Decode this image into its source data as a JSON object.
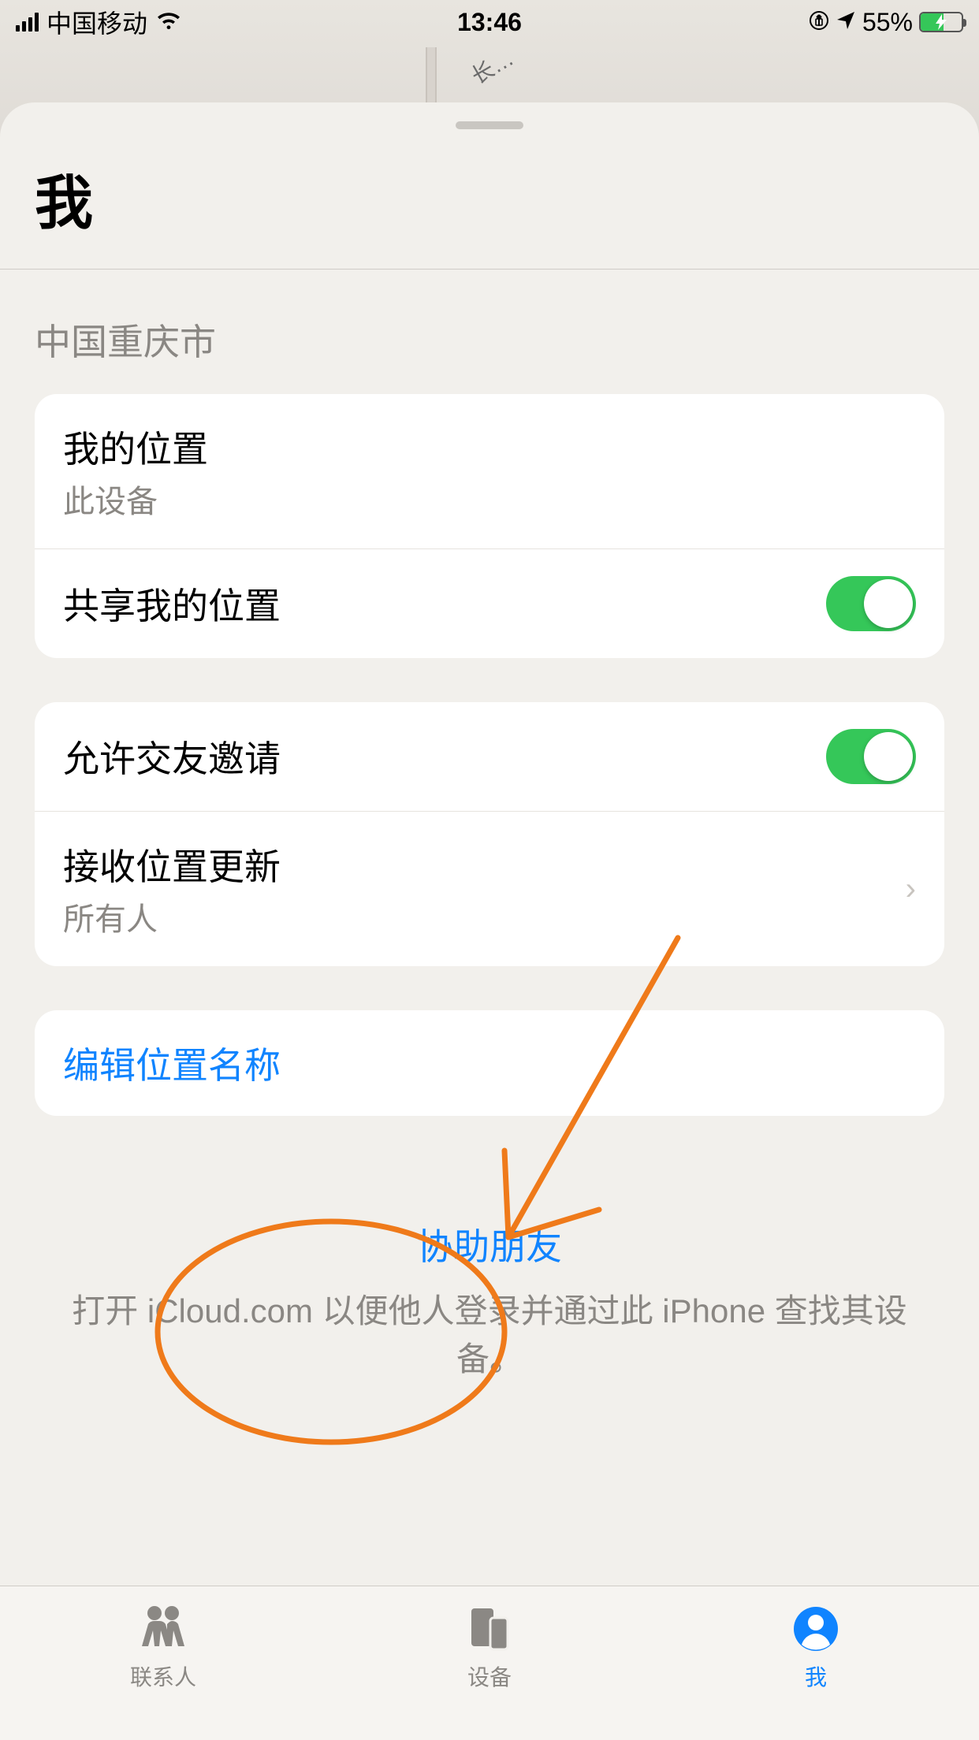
{
  "status": {
    "carrier": "中国移动",
    "time": "13:46",
    "battery_pct": "55%"
  },
  "map": {
    "peek_label": "长…"
  },
  "sheet": {
    "title": "我",
    "location_header": "中国重庆市"
  },
  "group1": {
    "my_location_title": "我的位置",
    "my_location_sub": "此设备",
    "share_title": "共享我的位置"
  },
  "group2": {
    "allow_friend_title": "允许交友邀请",
    "receive_updates_title": "接收位置更新",
    "receive_updates_sub": "所有人"
  },
  "group3": {
    "edit_name": "编辑位置名称"
  },
  "help": {
    "link": "协助朋友",
    "desc": "打开 iCloud.com 以便他人登录并通过此 iPhone 查找其设备。"
  },
  "tabs": {
    "people": "联系人",
    "devices": "设备",
    "me": "我"
  }
}
